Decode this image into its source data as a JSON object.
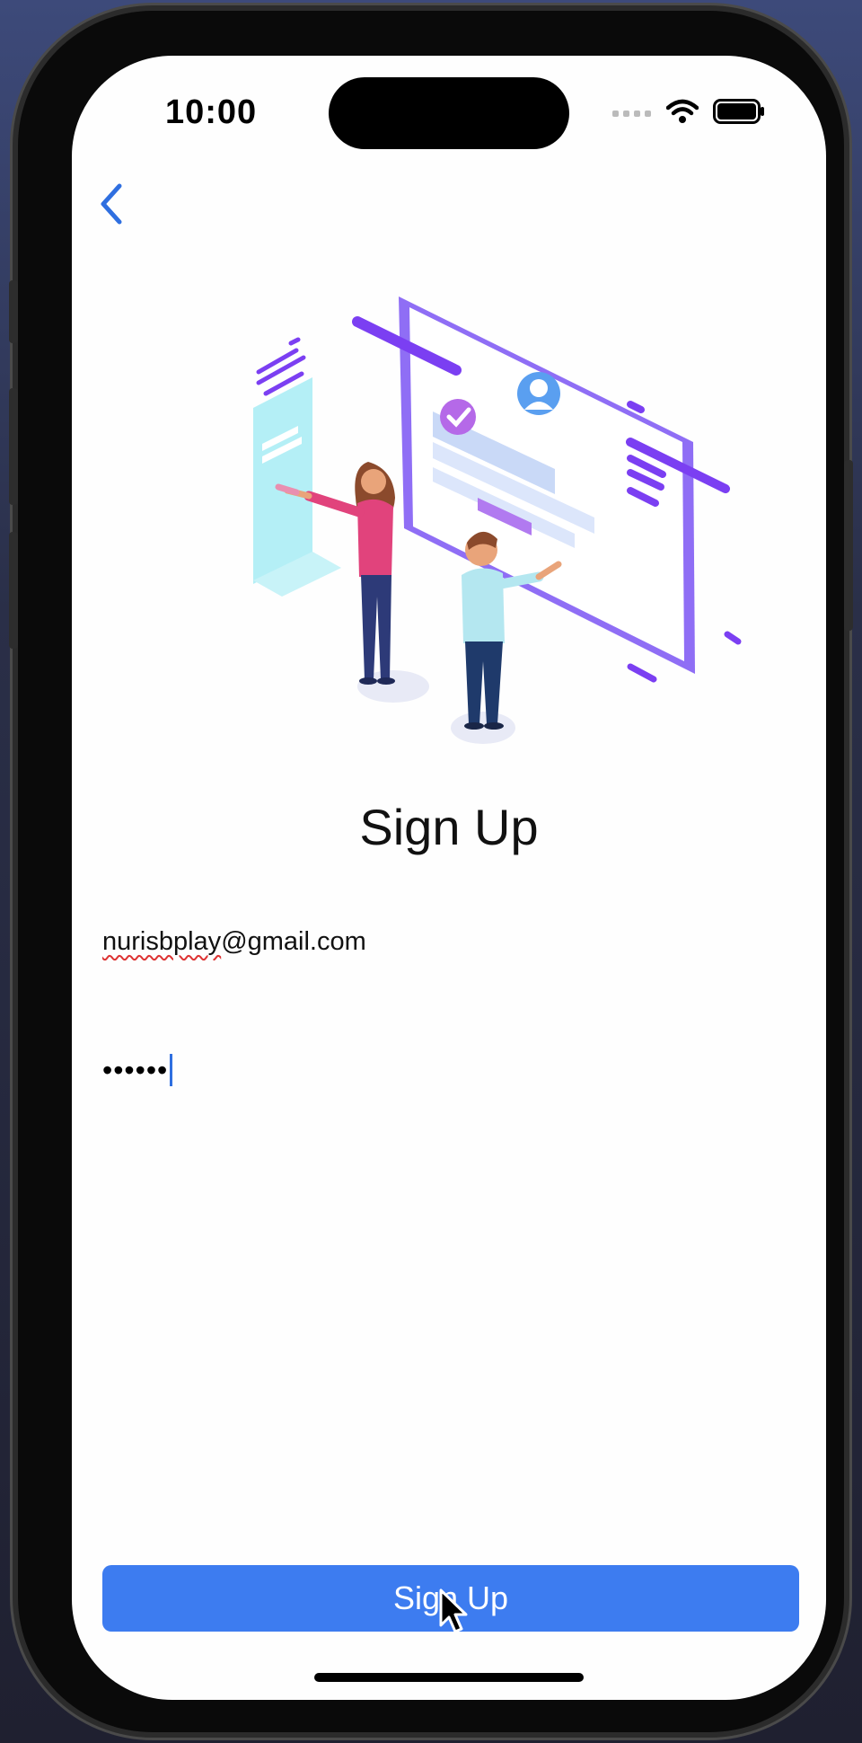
{
  "status_bar": {
    "time": "10:00"
  },
  "nav": {
    "back_icon": "chevron-left-icon"
  },
  "form": {
    "title": "Sign Up",
    "email_value_part1": "nurisbplay",
    "email_value_part2": "@gmail.com",
    "password_value": "••••••"
  },
  "actions": {
    "signup_label": "Sign Up"
  },
  "colors": {
    "accent": "#3d7cf0",
    "back_chevron": "#2f6fe0",
    "purple": "#7b3ff2",
    "pink": "#e13c8f"
  }
}
